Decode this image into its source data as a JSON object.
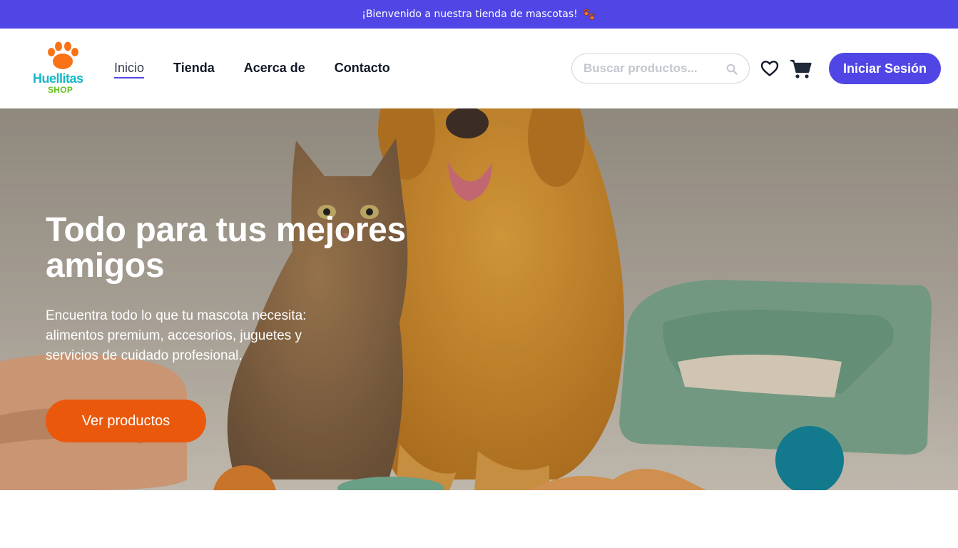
{
  "banner": {
    "text": "¡Bienvenido a nuestra tienda de mascotas!"
  },
  "brand": {
    "name_line1": "Huellitas",
    "name_line2": "SHOP",
    "colors": {
      "paw": "#f97316",
      "name": "#14b8c8",
      "shop": "#65c11d"
    }
  },
  "nav": {
    "items": [
      {
        "label": "Inicio",
        "active": true
      },
      {
        "label": "Tienda",
        "active": false
      },
      {
        "label": "Acerca de",
        "active": false
      },
      {
        "label": "Contacto",
        "active": false
      }
    ]
  },
  "search": {
    "placeholder": "Buscar productos...",
    "value": "",
    "icon": "search-icon"
  },
  "actions": {
    "wishlist_icon": "heart-icon",
    "cart_icon": "cart-icon",
    "login_label": "Iniciar Sesión"
  },
  "hero": {
    "title": "Todo para tus mejores amigos",
    "subtitle": "Encuentra todo lo que tu mascota necesita: alimentos premium, accesorios, juguetes y servicios de cuidado profesional.",
    "cta_label": "Ver productos",
    "image": "cat-and-dog-with-pet-bed-photo"
  },
  "theme": {
    "primary": "#4f46e5",
    "accent": "#ea580c"
  }
}
